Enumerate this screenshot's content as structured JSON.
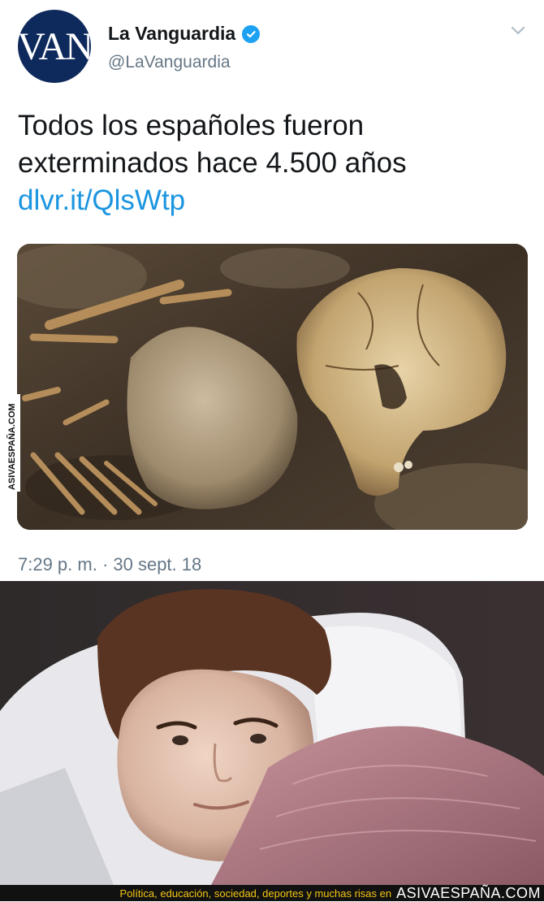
{
  "tweet": {
    "avatar_text": "VAN",
    "display_name": "La Vanguardia",
    "handle": "@LaVanguardia",
    "text_lines": [
      "Todos los españoles fueron",
      "exterminados hace 4.500 años"
    ],
    "link": "dlvr.it/QlsWtp",
    "timestamp": "7:29 p. m. · 30 sept. 18",
    "media_icon": "excavated-skeleton-photo"
  },
  "side_watermark": "ASIVAESPAÑA.COM",
  "meme": {
    "image_icon": "man-in-bed-looking-at-camera-photo"
  },
  "footer": {
    "tagline": "Política, educación, sociedad, deportes y muchas risas en",
    "brand": "ASIVAESPAÑA.COM"
  },
  "colors": {
    "link": "#1b95e0",
    "verified": "#1da1f2",
    "secondary_text": "#657786",
    "avatar_bg": "#0e2a5c",
    "footer_bg": "#111111",
    "footer_text": "#f3c613"
  }
}
